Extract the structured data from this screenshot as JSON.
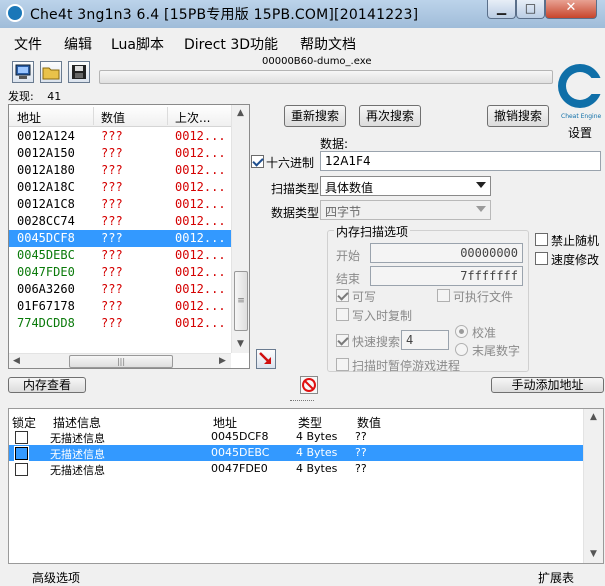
{
  "window": {
    "title": "Che4t 3ng1n3 6.4 [15PB专用版 15PB.COM][20141223]",
    "min_glyph": "▁",
    "max_glyph": "□",
    "close_glyph": "✕"
  },
  "menu": [
    "文件",
    "编辑",
    "Lua脚本",
    "Direct 3D功能",
    "帮助文档"
  ],
  "toolbar": {
    "process_name": "00000B60-dumo_.exe",
    "found_label": "发现:",
    "found_count": "41",
    "settings_label": "设置",
    "logo_text": "Cheat Engine"
  },
  "address_list": {
    "headers": [
      "地址",
      "数值",
      "上次..."
    ],
    "rows": [
      {
        "address": "0012A124",
        "value": "???",
        "previous": "0012...",
        "color": "#000000"
      },
      {
        "address": "0012A150",
        "value": "???",
        "previous": "0012...",
        "color": "#000000"
      },
      {
        "address": "0012A180",
        "value": "???",
        "previous": "0012...",
        "color": "#000000"
      },
      {
        "address": "0012A18C",
        "value": "???",
        "previous": "0012...",
        "color": "#000000"
      },
      {
        "address": "0012A1C8",
        "value": "???",
        "previous": "0012...",
        "color": "#000000"
      },
      {
        "address": "0028CC74",
        "value": "???",
        "previous": "0012...",
        "color": "#000000"
      },
      {
        "address": "0045DCF8",
        "value": "???",
        "previous": "0012...",
        "color": "#ffffff"
      },
      {
        "address": "0045DEBC",
        "value": "???",
        "previous": "0012...",
        "color": "#0a7a0a"
      },
      {
        "address": "0047FDE0",
        "value": "???",
        "previous": "0012...",
        "color": "#0a7a0a"
      },
      {
        "address": "006A3260",
        "value": "???",
        "previous": "0012...",
        "color": "#000000"
      },
      {
        "address": "01F67178",
        "value": "???",
        "previous": "0012...",
        "color": "#000000"
      },
      {
        "address": "774DCDD8",
        "value": "???",
        "previous": "0012...",
        "color": "#0a7a0a"
      }
    ],
    "selected_index": 6,
    "value_color": "#d40000",
    "hscroll_grip": "|||",
    "vscroll_grip": "≡"
  },
  "scan": {
    "first_scan": "重新搜索",
    "next_scan": "再次搜索",
    "undo_scan": "撤销搜索",
    "value_label": "数据:",
    "hex_label": "十六进制",
    "hex_checked": true,
    "value_input": "12A1F4",
    "scan_type_label": "扫描类型",
    "scan_type_value": "具体数值",
    "value_type_label": "数据类型",
    "value_type_value": "四字节",
    "memory_options_label": "内存扫描选项",
    "start_label": "开始",
    "start_value": "00000000",
    "stop_label": "结束",
    "stop_value": "7fffffff",
    "writable_label": "可写",
    "executable_label": "可执行文件",
    "copy_on_write_label": "写入时复制",
    "fast_scan_label": "快速搜索",
    "fast_scan_value": "4",
    "aligned_label": "校准",
    "last_digits_label": "末尾数字",
    "pause_label": "扫描时暂停游戏进程",
    "unrandomizer_label": "禁止随机",
    "speedhack_label": "速度修改"
  },
  "actions": {
    "memory_view": "内存查看",
    "add_address": "手动添加地址"
  },
  "cheat_table": {
    "headers": [
      "锁定",
      "描述信息",
      "地址",
      "类型",
      "数值"
    ],
    "rows": [
      {
        "description": "无描述信息",
        "address": "0045DCF8",
        "type": "4 Bytes",
        "value": "??"
      },
      {
        "description": "无描述信息",
        "address": "0045DEBC",
        "type": "4 Bytes",
        "value": "??"
      },
      {
        "description": "无描述信息",
        "address": "0047FDE0",
        "type": "4 Bytes",
        "value": "??"
      }
    ],
    "selected_index": 1
  },
  "status": {
    "advanced_options": "高级选项",
    "table_extras": "扩展表"
  },
  "colors": {
    "selection": "#3399ff",
    "titlebar": "#9fbcd9"
  }
}
